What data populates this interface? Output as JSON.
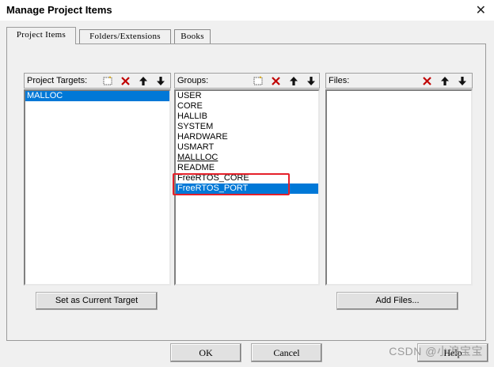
{
  "window": {
    "title": "Manage Project Items",
    "close_glyph": "✕"
  },
  "tabs": [
    {
      "label": "Project Items",
      "active": true
    },
    {
      "label": "Folders/Extensions",
      "active": false
    },
    {
      "label": "Books",
      "active": false
    }
  ],
  "targets": {
    "header": "Project Targets:",
    "items": [
      {
        "label": "MALLOC",
        "selected": true
      }
    ],
    "set_current_button": "Set as Current Target"
  },
  "groups": {
    "header": "Groups:",
    "items": [
      {
        "label": "USER",
        "selected": false
      },
      {
        "label": "CORE",
        "selected": false
      },
      {
        "label": "HALLIB",
        "selected": false
      },
      {
        "label": "SYSTEM",
        "selected": false
      },
      {
        "label": "HARDWARE",
        "selected": false
      },
      {
        "label": "USMART",
        "selected": false
      },
      {
        "label": "MALLLOC",
        "selected": false
      },
      {
        "label": "README",
        "selected": false
      },
      {
        "label": "FreeRTOS_CORE",
        "selected": false
      },
      {
        "label": "FreeRTOS_PORT",
        "selected": true
      }
    ]
  },
  "files": {
    "header": "Files:",
    "add_files_button": "Add Files..."
  },
  "footer": {
    "ok_label": "OK",
    "cancel_label": "Cancel",
    "help_label": "Help"
  },
  "watermark": "CSDN @小浪宝宝",
  "colors": {
    "selection": "#0078d7",
    "highlight_box": "#e5202a",
    "delete_icon": "#c00000"
  },
  "icons": [
    "new-item-icon",
    "delete-icon",
    "move-up-icon",
    "move-down-icon",
    "close-icon"
  ]
}
